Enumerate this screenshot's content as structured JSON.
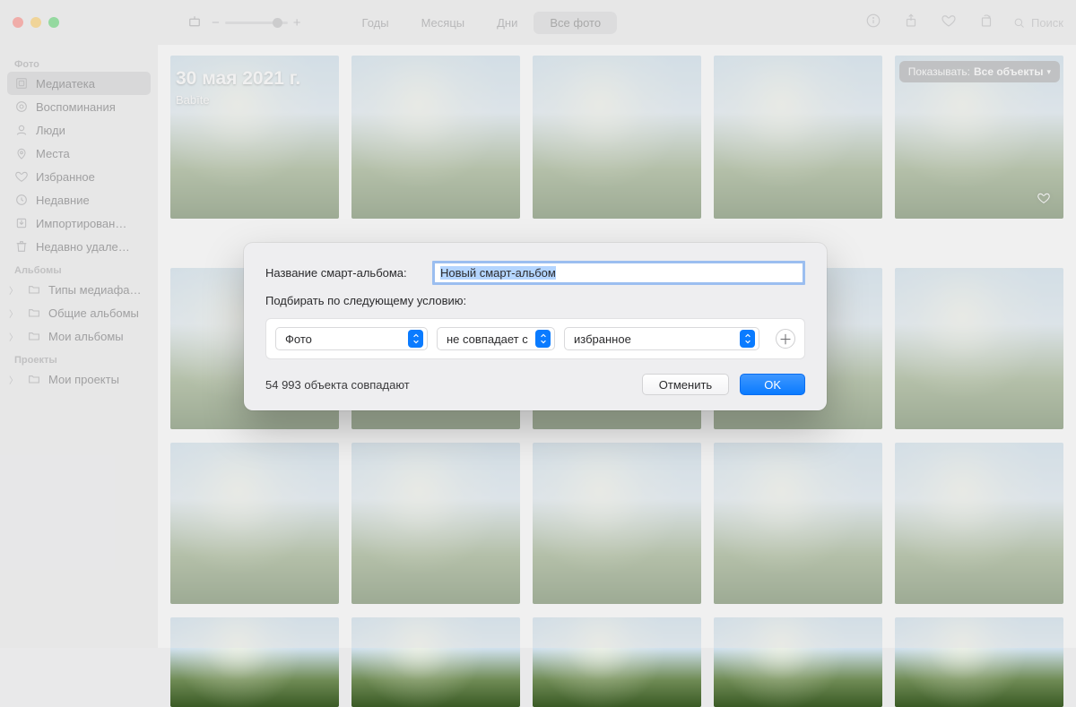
{
  "toolbar": {
    "segments": {
      "years": "Годы",
      "months": "Месяцы",
      "days": "Дни",
      "all": "Все фото"
    },
    "search_placeholder": "Поиск"
  },
  "header_overlay": {
    "date": "30 мая 2021 г.",
    "place": "Babīte"
  },
  "show_pill": {
    "prefix": "Показывать:",
    "value": "Все объекты"
  },
  "sidebar": {
    "section_photos": "Фото",
    "items_photos": [
      {
        "label": "Медиатека"
      },
      {
        "label": "Воспоминания"
      },
      {
        "label": "Люди"
      },
      {
        "label": "Места"
      },
      {
        "label": "Избранное"
      },
      {
        "label": "Недавние"
      },
      {
        "label": "Импортирован…"
      },
      {
        "label": "Недавно удале…"
      }
    ],
    "section_albums": "Альбомы",
    "items_albums": [
      {
        "label": "Типы медиафай…"
      },
      {
        "label": "Общие альбомы"
      },
      {
        "label": "Мои альбомы"
      }
    ],
    "section_projects": "Проекты",
    "items_projects": [
      {
        "label": "Мои проекты"
      }
    ]
  },
  "dialog": {
    "name_label": "Название смарт-альбома:",
    "name_value": "Новый смарт-альбом",
    "condition_label": "Подбирать по следующему условию:",
    "rule": {
      "field": "Фото",
      "operator": "не совпадает с",
      "value": "избранное"
    },
    "match_count": "54 993 объекта совпадают",
    "cancel": "Отменить",
    "ok": "OK"
  }
}
